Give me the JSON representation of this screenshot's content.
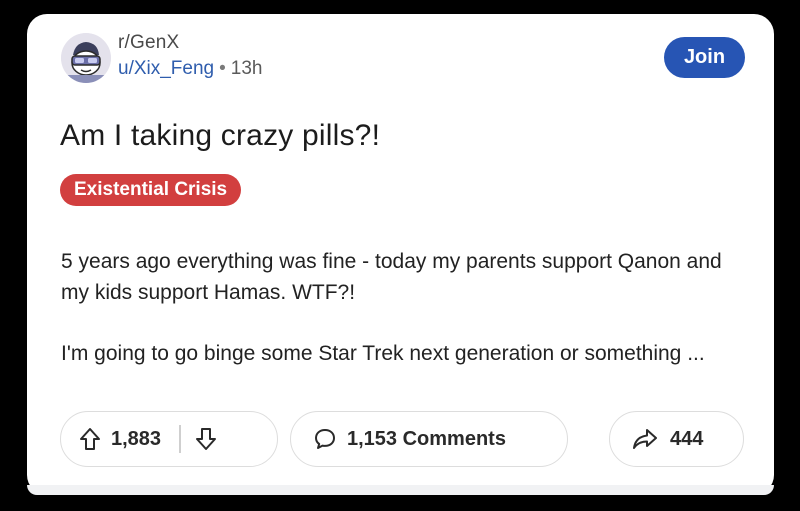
{
  "post": {
    "subreddit": "r/GenX",
    "author": "u/Xix_Feng",
    "separator": "•",
    "age": "13h",
    "join_label": "Join",
    "title": "Am I taking crazy pills?!",
    "flair": "Existential Crisis",
    "body": [
      "5 years ago everything was fine - today my parents support Qanon and my kids support Hamas. WTF?!",
      "I'm going to go binge some Star Trek next generation or something ..."
    ]
  },
  "actions": {
    "upvotes": "1,883",
    "comments": "1,153 Comments",
    "shares": "444"
  },
  "icons": {
    "avatar": "snoo-avatar-icon",
    "upvote": "arrow-up-icon",
    "downvote": "arrow-down-icon",
    "comment": "speech-bubble-icon",
    "share": "share-arrow-icon"
  },
  "colors": {
    "join_button": "#2755b4",
    "flair": "#d23f3f",
    "author_link": "#2f5dad"
  }
}
